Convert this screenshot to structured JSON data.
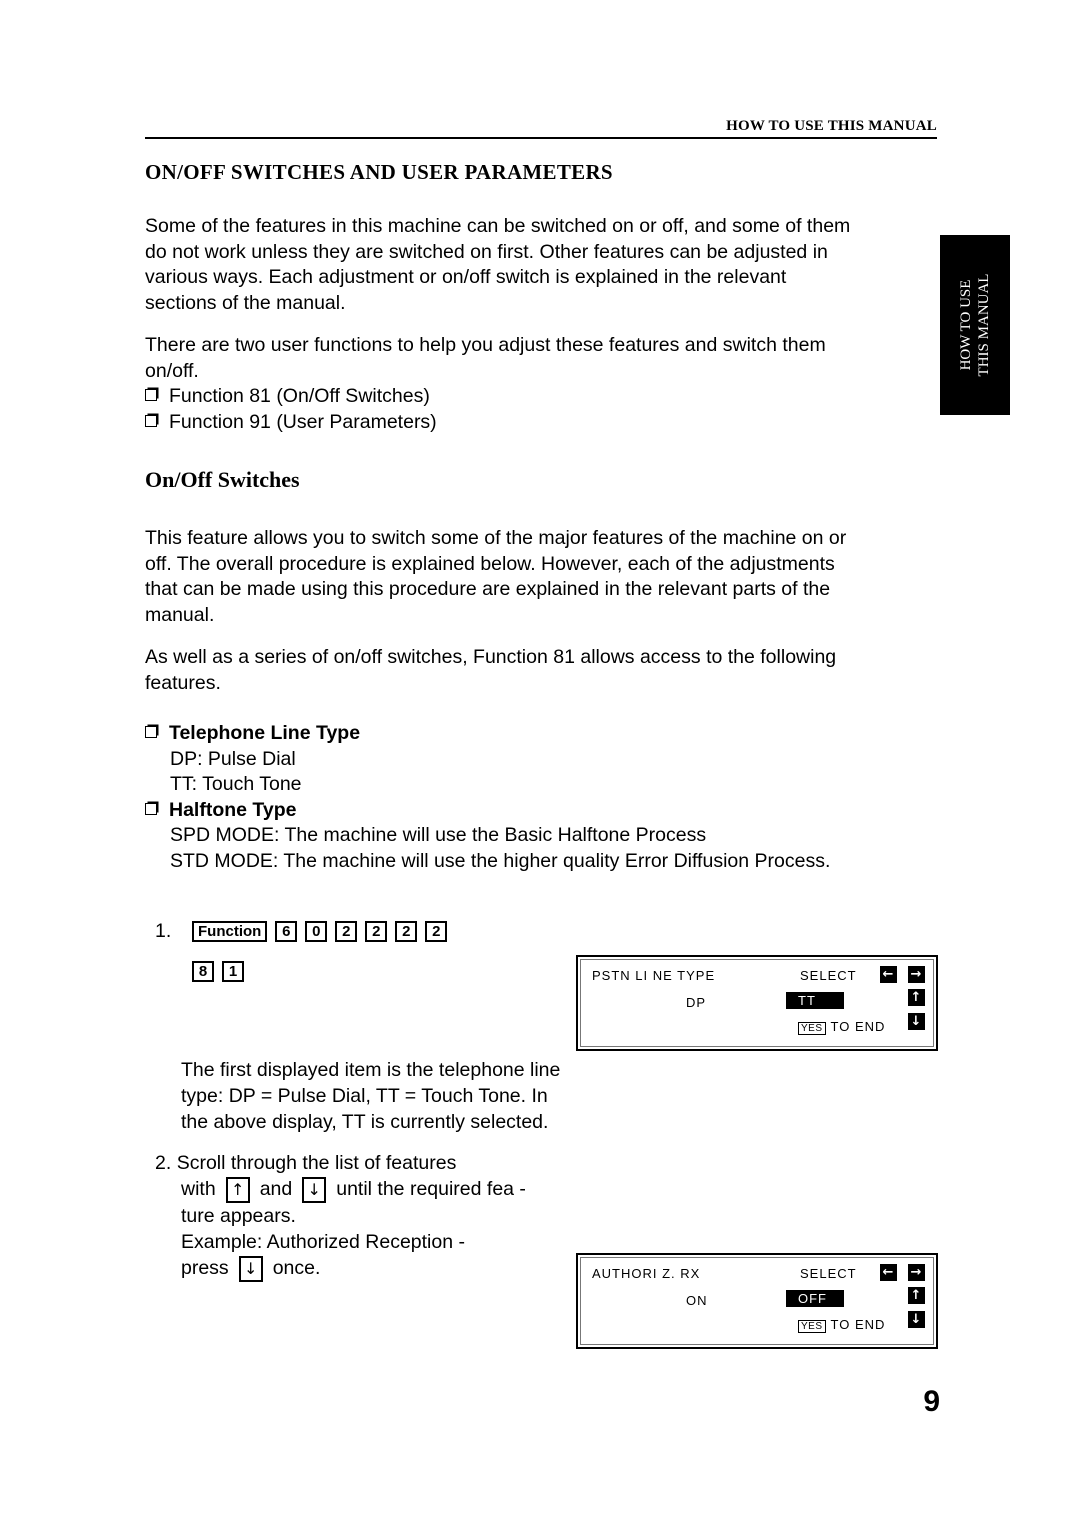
{
  "running_head": "HOW TO USE THIS MANUAL",
  "side_tab": {
    "line1": "HOW TO USE",
    "line2": "THIS MANUAL"
  },
  "section_title": "ON/OFF SWITCHES AND USER PARAMETERS",
  "intro": {
    "p1_lines": [
      "Some of the features in this machine can be switched on or off, and some of them",
      "do not work unless they are switched on first. Other features can be adjusted in",
      "various ways. Each adjustment or on/off switch is explained in the relevant",
      "sections of the manual."
    ],
    "p2_lines": [
      "There are two user functions to help you adjust these features and switch them",
      "on/off."
    ],
    "functions": [
      "Function 81 (On/Off Switches)",
      "Function 91 (User Parameters)"
    ]
  },
  "subsection_title": "On/Off Switches",
  "onoff": {
    "p1_lines": [
      "This feature allows you to switch some of the major features of the machine on or",
      "off. The overall procedure is explained below. However, each of the adjustments",
      "that can be made using this procedure are explained in the relevant parts of the",
      "manual."
    ],
    "p2_lines": [
      "As well as a series of on/off switches, Function 81 allows access to the following",
      "features."
    ],
    "features": [
      {
        "title": "Telephone Line Type",
        "lines": [
          "DP: Pulse Dial",
          "TT: Touch Tone"
        ]
      },
      {
        "title": "Halftone Type",
        "lines": [
          "SPD MODE: The machine will use the Basic Halftone Process",
          "STD MODE: The machine will use the higher quality Error Diffusion Process."
        ]
      }
    ]
  },
  "step1": {
    "number": "1.",
    "keys_row1": [
      "Function",
      "6",
      "0",
      "2",
      "2",
      "2",
      "2"
    ],
    "keys_row2": [
      "8",
      "1"
    ],
    "desc_lines": [
      "The first displayed item is the telephone line",
      "type: DP = Pulse Dial, TT = Touch Tone. In",
      "the above display, TT is currently selected."
    ]
  },
  "lcd1": {
    "label": "PSTN LI NE TYPE",
    "select": "SELECT",
    "option": "DP",
    "selected": "TT",
    "yes": "YES",
    "to_end": "TO END",
    "arrows": {
      "left": "←",
      "right": "→",
      "up": "↑",
      "down": "↓"
    }
  },
  "step2": {
    "number": "2.",
    "line1": "Scroll through the list of features",
    "with": "with",
    "and": "and",
    "until": "until the required fea -",
    "line3": "ture appears.",
    "line4": "Example: Authorized Reception -",
    "press": "press",
    "once": "once.",
    "up_arrow": "↑",
    "down_arrow": "↓"
  },
  "lcd2": {
    "label": "AUTHORI Z. RX",
    "select": "SELECT",
    "option": "ON",
    "selected": "OFF",
    "yes": "YES",
    "to_end": "TO END",
    "arrows": {
      "left": "←",
      "right": "→",
      "up": "↑",
      "down": "↓"
    }
  },
  "page_number": "9"
}
